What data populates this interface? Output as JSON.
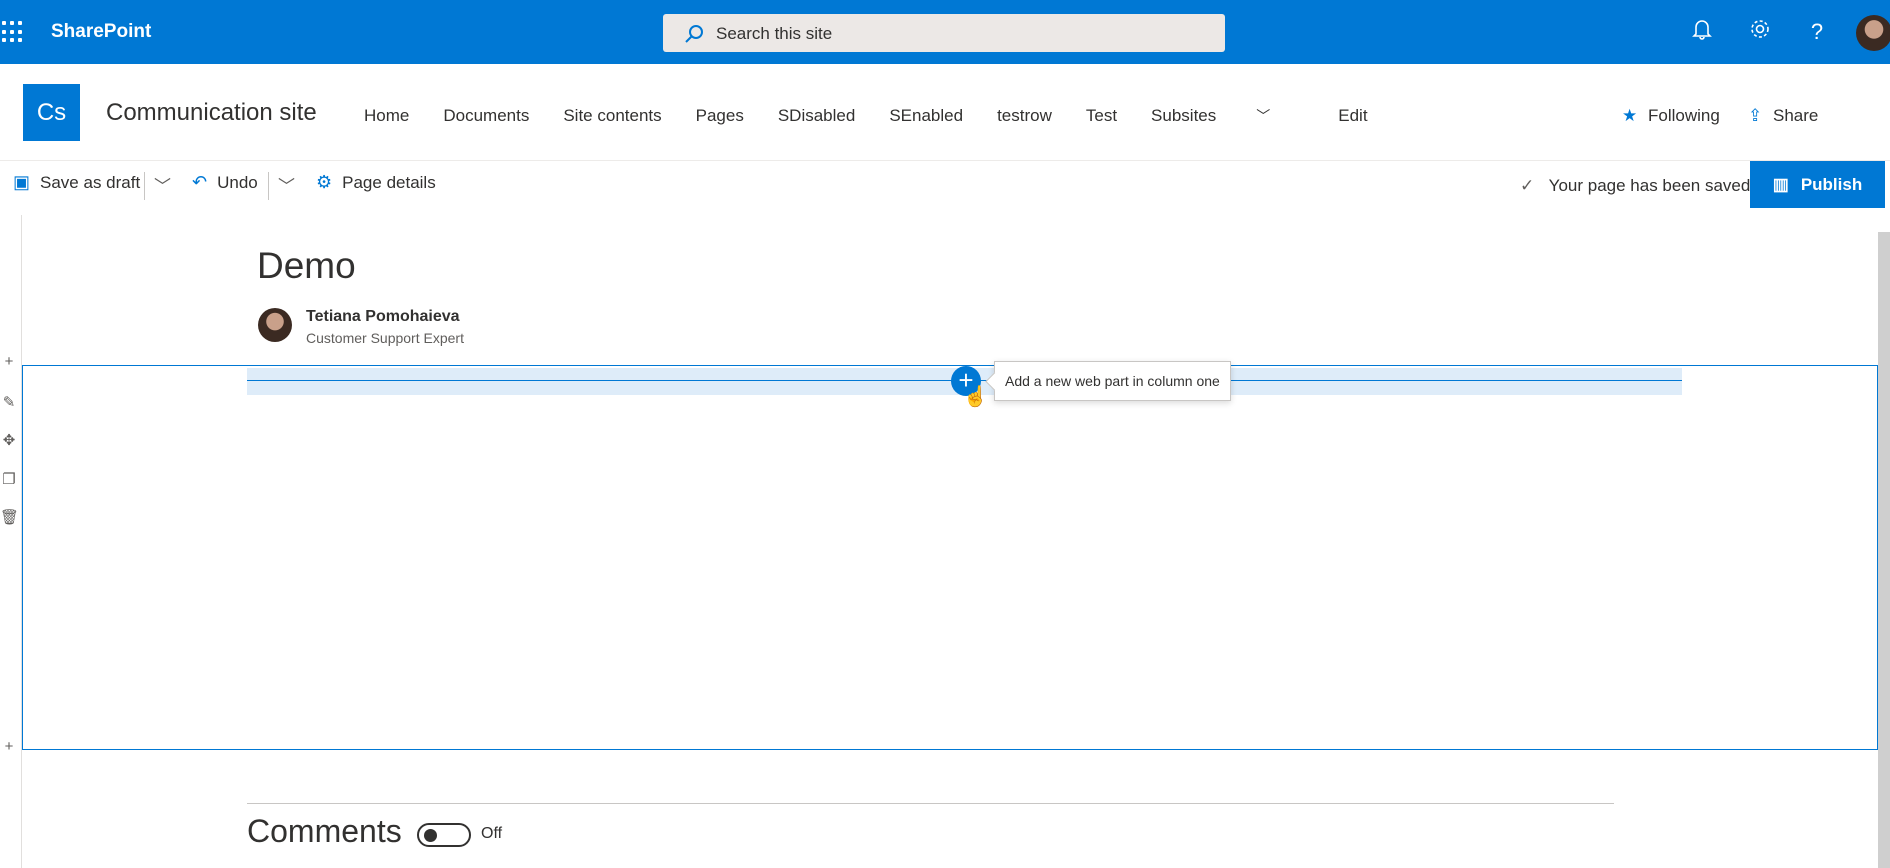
{
  "suitebar": {
    "brand": "SharePoint",
    "search_placeholder": "Search this site",
    "icons": [
      "app-launcher-icon",
      "bell-icon",
      "gear-icon",
      "help-icon"
    ]
  },
  "site": {
    "logo_text": "Cs",
    "title": "Communication site",
    "nav": [
      "Home",
      "Documents",
      "Site contents",
      "Pages",
      "SDisabled",
      "SEnabled",
      "testrow",
      "Test",
      "Subsites",
      "Edit"
    ],
    "following": "Following",
    "share": "Share"
  },
  "commandbar": {
    "save_draft": "Save as draft",
    "undo": "Undo",
    "page_details": "Page details",
    "status": "Your page has been saved",
    "publish": "Publish"
  },
  "page": {
    "title": "Demo",
    "author_name": "Tetiana Pomohaieva",
    "author_role": "Customer Support Expert",
    "add_webpart_tooltip": "Add a new web part in column one"
  },
  "comments": {
    "heading": "Comments",
    "toggle_label": "Off"
  },
  "colors": {
    "accent": "#0078d4",
    "band": "#deecf9"
  }
}
